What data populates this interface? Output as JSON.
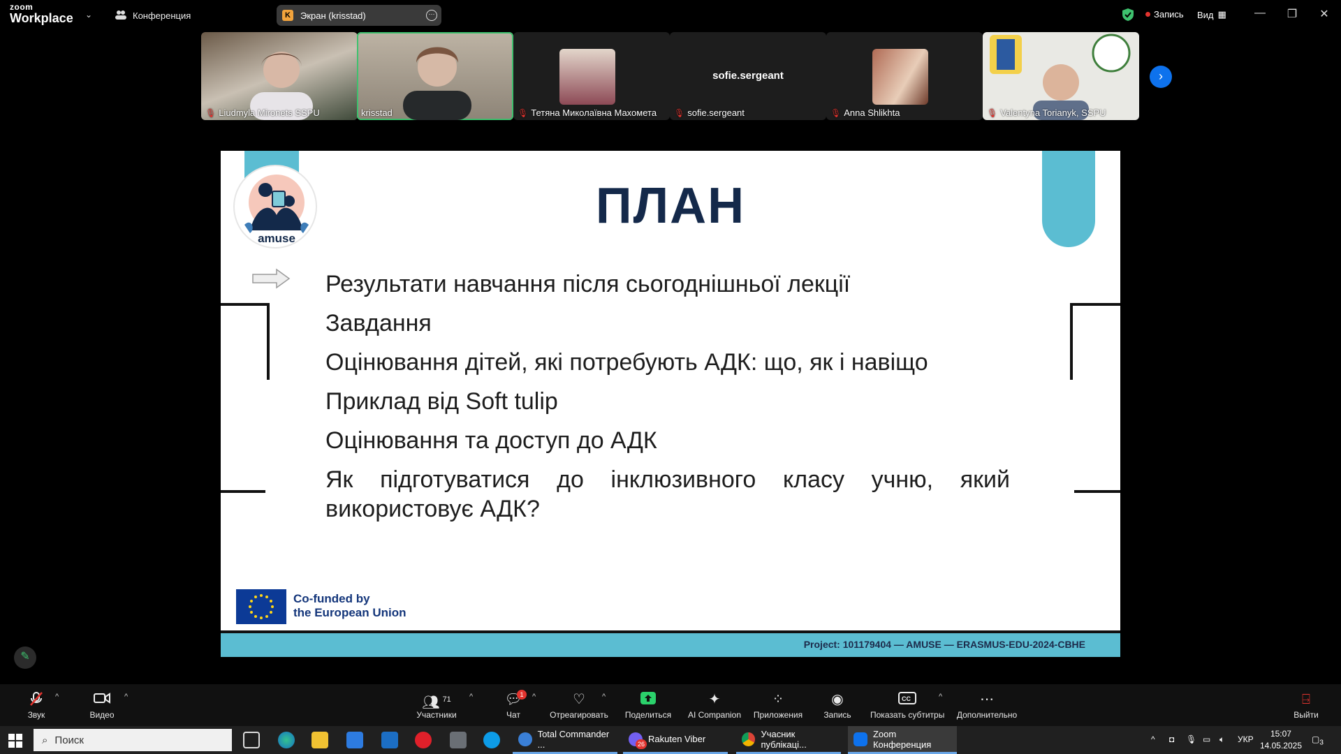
{
  "topbar": {
    "logo_line1": "zoom",
    "logo_line2": "Workplace",
    "meeting_label": "Конференция",
    "share_label": "Экран (krisstad)",
    "share_initial": "K",
    "record_label": "Запись",
    "view_label": "Вид"
  },
  "participants": [
    {
      "name": "Liudmyla Mironets SSPU",
      "muted": true
    },
    {
      "name": "krisstad",
      "muted": false
    },
    {
      "name": "Тетяна Миколаївна Махомета",
      "muted": true
    },
    {
      "name": "sofie.sergeant",
      "muted": true,
      "center_text": "sofie.sergeant"
    },
    {
      "name": "Anna Shlikhta",
      "muted": true
    },
    {
      "name": "Valentyna Torianyk, SSPU",
      "muted": true
    }
  ],
  "slide": {
    "logo_text": "amuse",
    "title": "ПЛАН",
    "agenda": [
      "Результати навчання після сьогоднішньої лекції",
      "Завдання",
      "Оцінювання дітей, які потребують АДК: що, як і навіщо",
      "Приклад від Soft tulip",
      "Оцінювання та доступ до АДК",
      "Як підготуватися до інклюзивного класу учню, який використовує АДК?"
    ],
    "eu_line1": "Co-funded by",
    "eu_line2": "the European Union",
    "project": "Project: 101179404 — AMUSE — ERASMUS-EDU-2024-CBHE"
  },
  "toolbar": {
    "audio": "Звук",
    "video": "Видео",
    "participants": "Участники",
    "participants_count": "71",
    "chat": "Чат",
    "chat_badge": "1",
    "react": "Отреагировать",
    "share": "Поделиться",
    "ai": "AI Companion",
    "apps": "Приложения",
    "record": "Запись",
    "captions": "Показать субтитры",
    "more": "Дополнительно",
    "leave": "Выйти"
  },
  "taskbar": {
    "search": "Поиск",
    "apps": [
      "Total Commander ...",
      "Rakuten Viber",
      "Учасник публікаці...",
      "Zoom Конференция"
    ],
    "viber_badge": "26",
    "lang": "УКР",
    "time": "15:07",
    "date": "14.05.2025",
    "notif": "3"
  },
  "colors": {
    "accent_green": "#3ec16e",
    "zoom_blue": "#0e72ed",
    "slide_title": "#14294a",
    "slide_teal": "#5bbdd2"
  }
}
